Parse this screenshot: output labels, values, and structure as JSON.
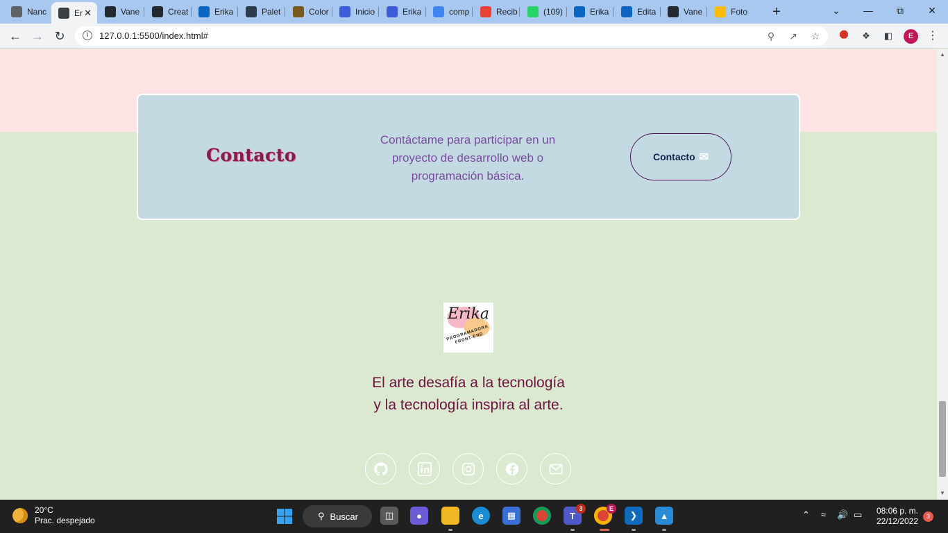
{
  "browser": {
    "tabs": [
      {
        "title": "Nanc",
        "icon": "generic-site-icon",
        "color": "#5f6368"
      },
      {
        "title": "Er",
        "icon": "globe-icon",
        "color": "#3c4043",
        "active": true
      },
      {
        "title": "Vane",
        "icon": "github-icon",
        "color": "#24292f"
      },
      {
        "title": "Creat",
        "icon": "github-icon",
        "color": "#24292f"
      },
      {
        "title": "Erika",
        "icon": "linkedin-icon",
        "color": "#0a66c2"
      },
      {
        "title": "Palet",
        "icon": "palette-site-icon",
        "color": "#2d3b4f"
      },
      {
        "title": "Color",
        "icon": "shield-site-icon",
        "color": "#7a5a1c"
      },
      {
        "title": "Inicio",
        "icon": "canva-icon",
        "color": "#3b5bdb"
      },
      {
        "title": "Erika",
        "icon": "canva-icon",
        "color": "#3b5bdb"
      },
      {
        "title": "comp",
        "icon": "google-icon",
        "color": "#4285f4"
      },
      {
        "title": "Recib",
        "icon": "gmail-icon",
        "color": "#ea4335"
      },
      {
        "title": "(109)",
        "icon": "whatsapp-icon",
        "color": "#25d366"
      },
      {
        "title": "Erika",
        "icon": "linkedin-icon",
        "color": "#0a66c2"
      },
      {
        "title": "Edita",
        "icon": "linkedin-icon",
        "color": "#0a66c2"
      },
      {
        "title": "Vane",
        "icon": "github-icon",
        "color": "#24292f"
      },
      {
        "title": "Foto",
        "icon": "google-photos-icon",
        "color": "#fbbc04"
      }
    ],
    "new_tab_glyph": "+",
    "address": {
      "url": "127.0.0.1:5500/index.html#"
    },
    "profile_initial": "E"
  },
  "page": {
    "contact": {
      "title": "Contacto",
      "text": "Contáctame para participar en un proyecto de desarrollo web o programación básica.",
      "button_label": "Contacto"
    },
    "logo": {
      "name": "Erika",
      "tagline": "PROGRAMADORA FRONT-END"
    },
    "tagline_line1": "El arte desafía a la tecnología",
    "tagline_line2": "y la tecnología inspira al arte.",
    "social": [
      {
        "name": "github",
        "icon": "github-icon"
      },
      {
        "name": "linkedin",
        "icon": "linkedin-icon"
      },
      {
        "name": "instagram",
        "icon": "instagram-icon"
      },
      {
        "name": "facebook",
        "icon": "facebook-icon"
      },
      {
        "name": "email",
        "icon": "mail-icon"
      }
    ],
    "colors": {
      "pink_band": "#fde3e3",
      "green_bg": "#dbe9d0",
      "card_bg": "#c4dae3",
      "title": "#8b1b4a",
      "text_purple": "#7a4aa0",
      "tagline": "#6e1440"
    }
  },
  "taskbar": {
    "weather": {
      "temp": "20°C",
      "condition": "Prac. despejado"
    },
    "search_label": "Buscar",
    "teams_badge": "3",
    "chrome_profile_badge": "E",
    "clock": {
      "time": "08:06 p. m.",
      "date": "22/12/2022"
    },
    "notification_count": "3"
  }
}
